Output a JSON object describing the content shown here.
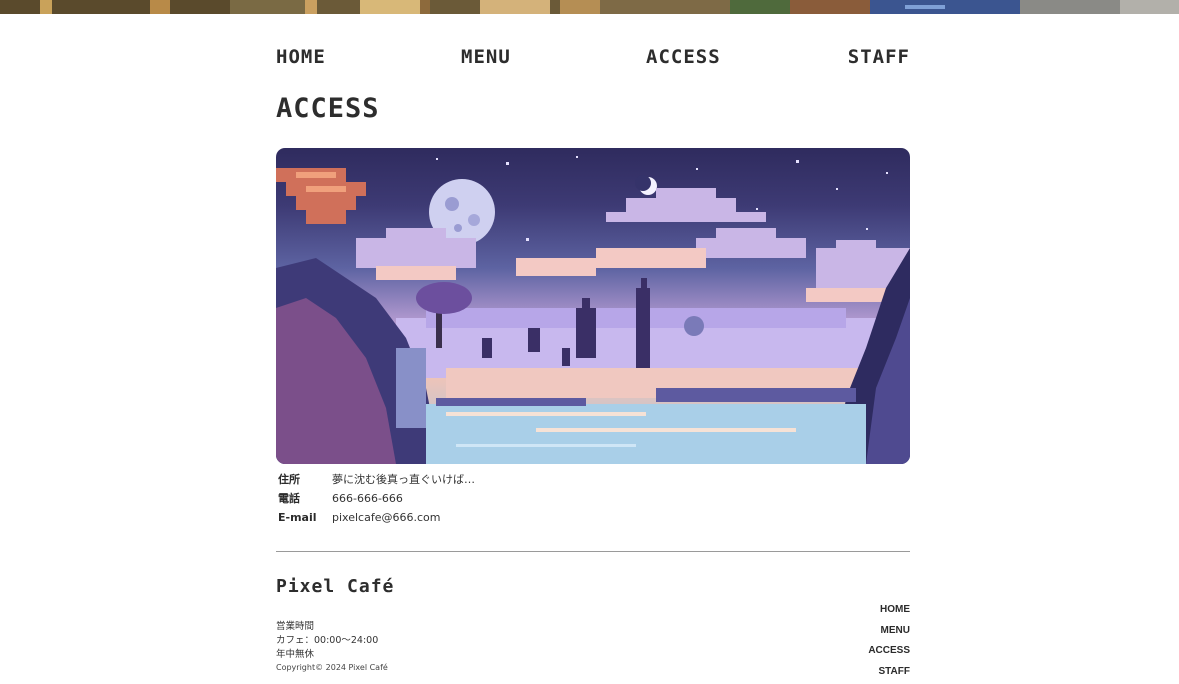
{
  "nav": {
    "home": "HOME",
    "menu": "MENU",
    "access": "ACCESS",
    "staff": "STAFF"
  },
  "page": {
    "title": "ACCESS"
  },
  "hero": {
    "description": "pixel-art fantasy landscape with moon, clouds, floating islands and sea",
    "colors": {
      "sky_top": "#2f2b5e",
      "sky_mid": "#6a6aa8",
      "cloud": "#c9b6e6",
      "sea": "#9fc3e0",
      "rock": "#3e3a78"
    }
  },
  "info": [
    {
      "label": "住所",
      "value": "夢に沈む後真っ直ぐいけば…"
    },
    {
      "label": "電話",
      "value": "666-666-666"
    },
    {
      "label": "E-mail",
      "value": "pixelcafe@666.com"
    }
  ],
  "footer": {
    "logo": "Pixel Café",
    "hours_title": "営業時間",
    "hours_cafe": "カフェ：00:00〜24:00",
    "hours_holiday": "年中無休",
    "copyright": "Copyright© 2024 Pixel Café",
    "nav": [
      "HOME",
      "MENU",
      "ACCESS",
      "STAFF"
    ]
  },
  "theme": {
    "text": "#2d2d2d",
    "divider": "#9a9a9a"
  }
}
